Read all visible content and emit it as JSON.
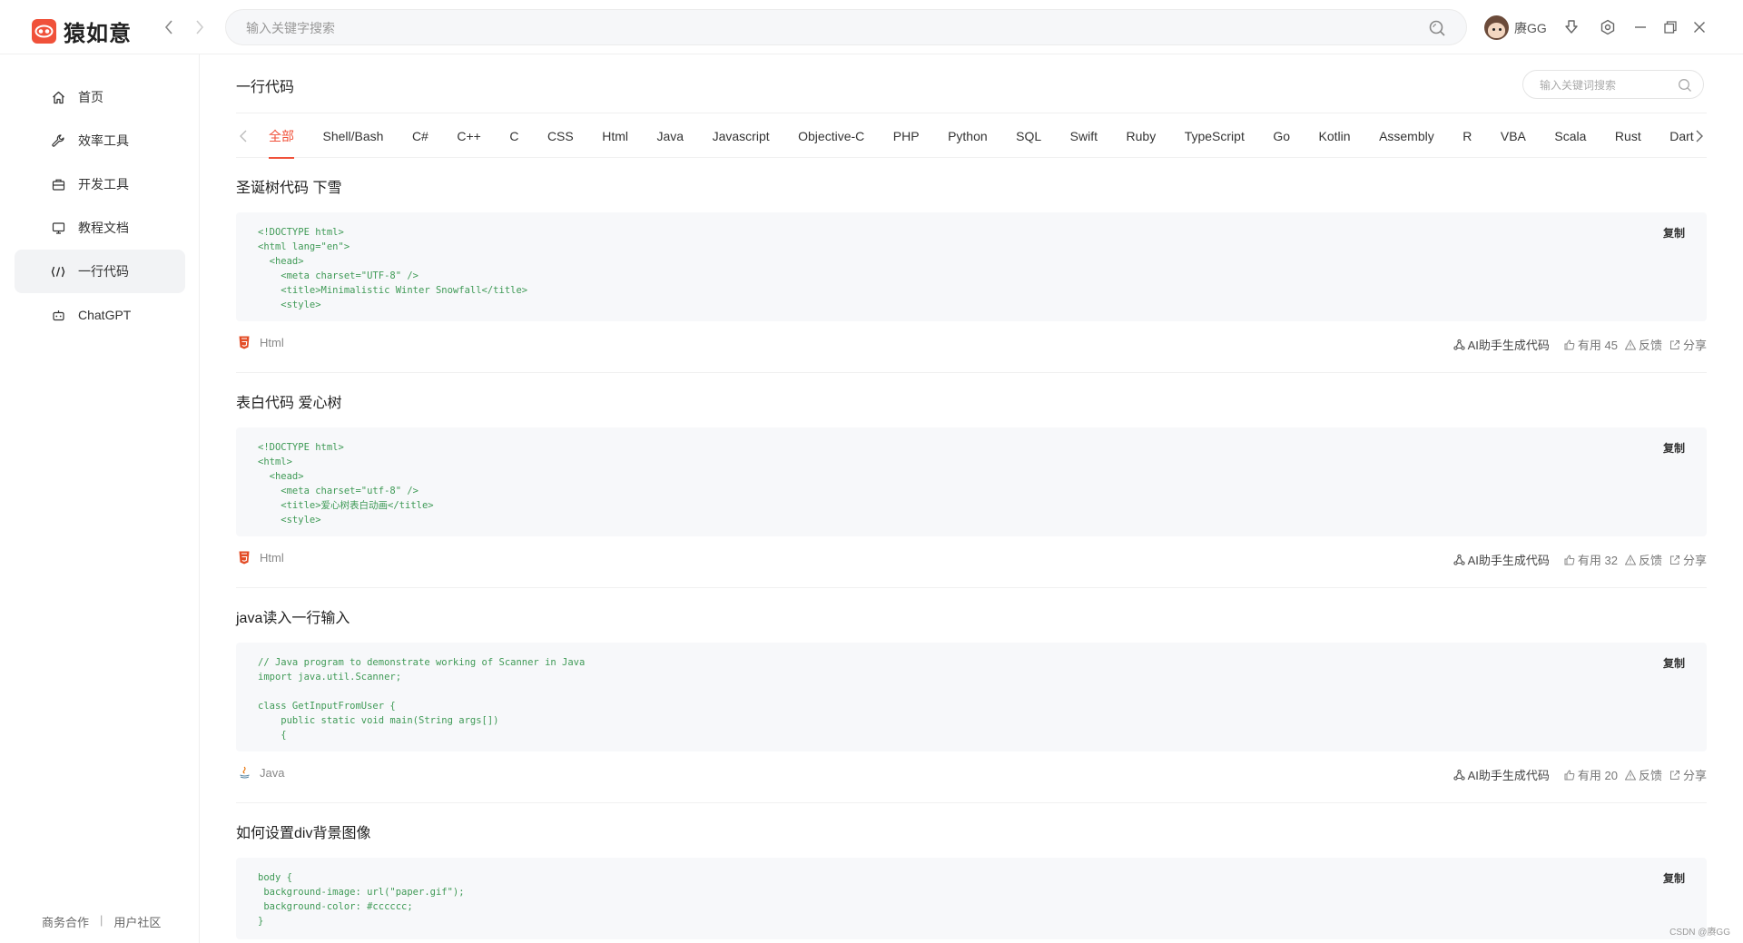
{
  "app": {
    "name": "猿如意",
    "accent_color": "#f0513a"
  },
  "topbar": {
    "search_placeholder": "输入关键字搜索",
    "username": "赓GG"
  },
  "sidebar": {
    "items": [
      {
        "label": "首页",
        "icon": "home-icon"
      },
      {
        "label": "效率工具",
        "icon": "wrench-icon"
      },
      {
        "label": "开发工具",
        "icon": "toolbox-icon"
      },
      {
        "label": "教程文档",
        "icon": "monitor-icon"
      },
      {
        "label": "一行代码",
        "icon": "code-icon",
        "active": true
      },
      {
        "label": "ChatGPT",
        "icon": "robot-icon"
      }
    ],
    "footer": {
      "business": "商务合作",
      "separator": "|",
      "community": "用户社区"
    }
  },
  "main": {
    "title": "一行代码",
    "keyword_search_placeholder": "输入关键词搜索",
    "tabs": [
      "全部",
      "Shell/Bash",
      "C#",
      "C++",
      "C",
      "CSS",
      "Html",
      "Java",
      "Javascript",
      "Objective-C",
      "PHP",
      "Python",
      "SQL",
      "Swift",
      "Ruby",
      "TypeScript",
      "Go",
      "Kotlin",
      "Assembly",
      "R",
      "VBA",
      "Scala",
      "Rust",
      "Dart"
    ],
    "active_tab": "全部",
    "copy_label": "复制",
    "ai_label": "AI助手生成代码",
    "feedback_label": "反馈",
    "share_label": "分享",
    "snippets": [
      {
        "title": "圣诞树代码 下雪",
        "code": "<!DOCTYPE html>\n<html lang=\"en\">\n  <head>\n    <meta charset=\"UTF-8\" />\n    <title>Minimalistic Winter Snowfall</title>\n    <style>",
        "language": "Html",
        "useful": "有用 45"
      },
      {
        "title": "表白代码 爱心树",
        "code": "<!DOCTYPE html>\n<html>\n  <head>\n    <meta charset=\"utf-8\" />\n    <title>爱心树表白动画</title>\n    <style>",
        "language": "Html",
        "useful": "有用 32"
      },
      {
        "title": "java读入一行输入",
        "code": "// Java program to demonstrate working of Scanner in Java\nimport java.util.Scanner;\n\nclass GetInputFromUser {\n    public static void main(String args[])\n    {",
        "language": "Java",
        "useful": "有用 20"
      },
      {
        "title": "如何设置div背景图像",
        "code": "body {\n background-image: url(\"paper.gif\");\n background-color: #cccccc;\n}",
        "language": "",
        "useful": ""
      }
    ]
  },
  "watermark": "CSDN @赓GG"
}
